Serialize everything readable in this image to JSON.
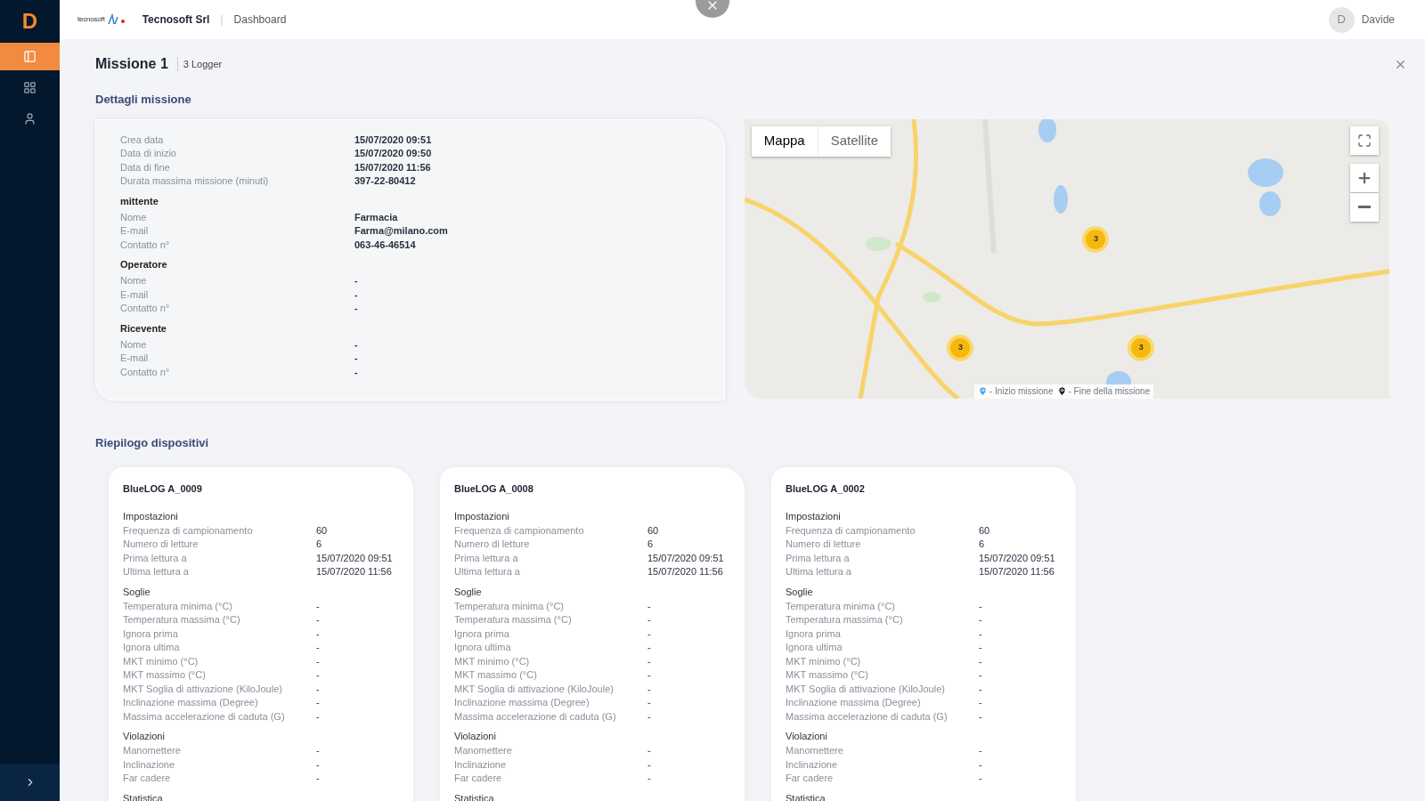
{
  "sidebar": {
    "logo": "D",
    "items": [
      {
        "kind": "panel",
        "selected": true
      },
      {
        "kind": "grid",
        "selected": false
      },
      {
        "kind": "user",
        "selected": false
      }
    ]
  },
  "header": {
    "logo_text": "tecnosoft",
    "company": "Tecnosoft Srl",
    "separator": "|",
    "breadcrumb": "Dashboard",
    "user": {
      "initial": "D",
      "name": "Davide"
    }
  },
  "mission": {
    "title": "Missione 1",
    "subtitle": "3 Logger"
  },
  "details": {
    "heading": "Dettagli missione",
    "groups": [
      {
        "rows": [
          {
            "label": "Crea data",
            "value": "15/07/2020 09:51"
          },
          {
            "label": "Data di inizio",
            "value": "15/07/2020 09:50"
          },
          {
            "label": "Data di fine",
            "value": "15/07/2020 11:56"
          },
          {
            "label": "Durata massima missione (minuti)",
            "value": "397-22-80412"
          }
        ]
      },
      {
        "title": "mittente",
        "rows": [
          {
            "label": "Nome",
            "value": "Farmacia"
          },
          {
            "label": "E-mail",
            "value": "Farma@milano.com"
          },
          {
            "label": "Contatto n°",
            "value": "063-46-46514"
          }
        ]
      },
      {
        "title": "Operatore",
        "rows": [
          {
            "label": "Nome",
            "value": "-"
          },
          {
            "label": "E-mail",
            "value": "-"
          },
          {
            "label": "Contatto n°",
            "value": "-"
          }
        ]
      },
      {
        "title": "Ricevente",
        "rows": [
          {
            "label": "Nome",
            "value": "-"
          },
          {
            "label": "E-mail",
            "value": "-"
          },
          {
            "label": "Contatto n°",
            "value": "-"
          }
        ]
      }
    ]
  },
  "map": {
    "tabs": [
      {
        "label": "Mappa",
        "selected": true
      },
      {
        "label": "Satellite",
        "selected": false
      }
    ],
    "clusters": [
      {
        "count": "3"
      },
      {
        "count": "3"
      },
      {
        "count": "3"
      }
    ],
    "legend": [
      {
        "kind": "start",
        "label": "- Inizio missione"
      },
      {
        "kind": "end",
        "label": "- Fine della missione"
      }
    ]
  },
  "summary": {
    "heading": "Riepilogo dispositivi",
    "devices": [
      {
        "name": "BlueLOG A_0009",
        "sections": [
          {
            "title": "Impostazioni",
            "rows": [
              {
                "label": "Frequenza di campionamento",
                "value": "60"
              },
              {
                "label": "Numero di letture",
                "value": "6"
              },
              {
                "label": "Prima lettura a",
                "value": "15/07/2020 09:51"
              },
              {
                "label": "Ultima lettura a",
                "value": "15/07/2020 11:56"
              }
            ]
          },
          {
            "title": "Soglie",
            "rows": [
              {
                "label": "Temperatura minima (°C)",
                "value": "-"
              },
              {
                "label": "Temperatura massima (°C)",
                "value": "-"
              },
              {
                "label": "Ignora prima",
                "value": "-"
              },
              {
                "label": "Ignora ultima",
                "value": "-"
              },
              {
                "label": "MKT minimo (°C)",
                "value": "-"
              },
              {
                "label": "MKT massimo (°C)",
                "value": "-"
              },
              {
                "label": "MKT Soglia di attivazione (KiloJoule)",
                "value": "-"
              },
              {
                "label": "Inclinazione massima (Degree)",
                "value": "-"
              },
              {
                "label": "Massima accelerazione di caduta (G)",
                "value": "-"
              }
            ]
          },
          {
            "title": "Violazioni",
            "rows": [
              {
                "label": "Manomettere",
                "value": "-"
              },
              {
                "label": "Inclinazione",
                "value": "-"
              },
              {
                "label": "Far cadere",
                "value": "-"
              }
            ]
          },
          {
            "title": "Statistica"
          }
        ]
      },
      {
        "name": "BlueLOG A_0008",
        "sections": [
          {
            "title": "Impostazioni",
            "rows": [
              {
                "label": "Frequenza di campionamento",
                "value": "60"
              },
              {
                "label": "Numero di letture",
                "value": "6"
              },
              {
                "label": "Prima lettura a",
                "value": "15/07/2020 09:51"
              },
              {
                "label": "Ultima lettura a",
                "value": "15/07/2020 11:56"
              }
            ]
          },
          {
            "title": "Soglie",
            "rows": [
              {
                "label": "Temperatura minima (°C)",
                "value": "-"
              },
              {
                "label": "Temperatura massima (°C)",
                "value": "-"
              },
              {
                "label": "Ignora prima",
                "value": "-"
              },
              {
                "label": "Ignora ultima",
                "value": "-"
              },
              {
                "label": "MKT minimo (°C)",
                "value": "-"
              },
              {
                "label": "MKT massimo (°C)",
                "value": "-"
              },
              {
                "label": "MKT Soglia di attivazione (KiloJoule)",
                "value": "-"
              },
              {
                "label": "Inclinazione massima (Degree)",
                "value": "-"
              },
              {
                "label": "Massima accelerazione di caduta (G)",
                "value": "-"
              }
            ]
          },
          {
            "title": "Violazioni",
            "rows": [
              {
                "label": "Manomettere",
                "value": "-"
              },
              {
                "label": "Inclinazione",
                "value": "-"
              },
              {
                "label": "Far cadere",
                "value": "-"
              }
            ]
          },
          {
            "title": "Statistica"
          }
        ]
      },
      {
        "name": "BlueLOG A_0002",
        "sections": [
          {
            "title": "Impostazioni",
            "rows": [
              {
                "label": "Frequenza di campionamento",
                "value": "60"
              },
              {
                "label": "Numero di letture",
                "value": "6"
              },
              {
                "label": "Prima lettura a",
                "value": "15/07/2020 09:51"
              },
              {
                "label": "Ultima lettura a",
                "value": "15/07/2020 11:56"
              }
            ]
          },
          {
            "title": "Soglie",
            "rows": [
              {
                "label": "Temperatura minima (°C)",
                "value": "-"
              },
              {
                "label": "Temperatura massima (°C)",
                "value": "-"
              },
              {
                "label": "Ignora prima",
                "value": "-"
              },
              {
                "label": "Ignora ultima",
                "value": "-"
              },
              {
                "label": "MKT minimo (°C)",
                "value": "-"
              },
              {
                "label": "MKT massimo (°C)",
                "value": "-"
              },
              {
                "label": "MKT Soglia di attivazione (KiloJoule)",
                "value": "-"
              },
              {
                "label": "Inclinazione massima (Degree)",
                "value": "-"
              },
              {
                "label": "Massima accelerazione di caduta (G)",
                "value": "-"
              }
            ]
          },
          {
            "title": "Violazioni",
            "rows": [
              {
                "label": "Manomettere",
                "value": "-"
              },
              {
                "label": "Inclinazione",
                "value": "-"
              },
              {
                "label": "Far cadere",
                "value": "-"
              }
            ]
          },
          {
            "title": "Statistica"
          }
        ]
      }
    ]
  }
}
